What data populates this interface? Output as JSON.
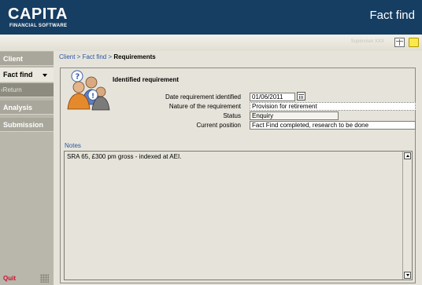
{
  "header": {
    "brand": "CAPITA",
    "brand_sub": "FINANCIAL SOFTWARE",
    "page_heading": "Fact find"
  },
  "toolbar": {
    "user_text": "Supervisor XXX",
    "buttons": [
      {
        "icon": "grid-icon"
      },
      {
        "icon": "sticky-note-icon"
      }
    ]
  },
  "sidebar": {
    "items": [
      {
        "label": "Client"
      },
      {
        "label": "Fact find"
      },
      {
        "label": "Return"
      },
      {
        "label": "Analysis"
      },
      {
        "label": "Submission"
      }
    ],
    "quit_label": "Quit"
  },
  "breadcrumb": {
    "client": "Client",
    "sep1": " > ",
    "factfind": "Fact find",
    "sep2": " > ",
    "current": "Requirements"
  },
  "requirement": {
    "title": "Identified requirement",
    "icon": "people-question-icon",
    "fields": {
      "date_label": "Date requirement identified",
      "date_value": "01/06/2011",
      "nature_label": "Nature of the requirement",
      "nature_value": "Provision for retirement",
      "status_label": "Status",
      "status_value": "Enquiry",
      "position_label": "Current position",
      "position_value": "Fact Find completed, research to be done"
    }
  },
  "notes": {
    "label": "Notes",
    "text": "SRA 65, £300 pm gross - indexed at AEI."
  },
  "colors": {
    "header_bg": "#163e62",
    "sidebar_bg": "#b9b7ab",
    "main_bg": "#e6e4da",
    "link": "#2a56a4",
    "quit": "#c8102e"
  }
}
